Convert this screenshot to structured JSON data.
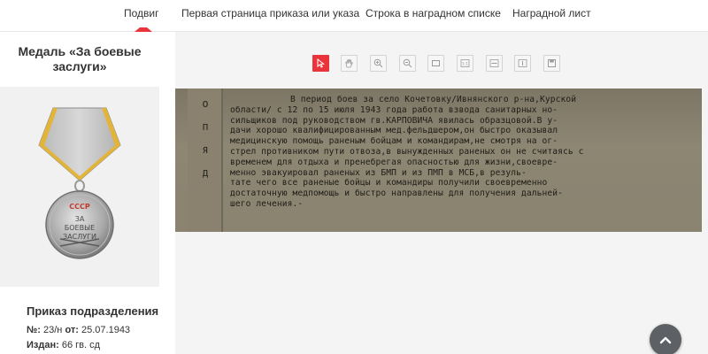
{
  "tabs": [
    {
      "label": "Подвиг",
      "active": true
    },
    {
      "label": "Первая страница приказа или указа",
      "active": false
    },
    {
      "label": "Строка в наградном списке",
      "active": false
    },
    {
      "label": "Наградной лист",
      "active": false
    }
  ],
  "colors": {
    "accent": "#e8343a",
    "viewer_bg": "#f4f4f4",
    "card_bg": "#f1f1f1"
  },
  "medal": {
    "title": "Медаль «За боевые заслуги»"
  },
  "order": {
    "title": "Приказ подразделения",
    "number_label": "№:",
    "number_value": "23/н",
    "date_label": "от:",
    "date_value": "25.07.1943",
    "issued_label": "Издан:",
    "issued_value": "66 гв. сд"
  },
  "toolbar": {
    "tools": [
      {
        "icon": "select-pointer-icon",
        "active": true
      },
      {
        "icon": "hand-pan-icon",
        "active": false
      },
      {
        "icon": "zoom-in-icon",
        "active": false
      },
      {
        "icon": "zoom-out-icon",
        "active": false
      },
      {
        "icon": "fit-page-icon",
        "active": false
      },
      {
        "icon": "actual-size-icon",
        "active": false
      },
      {
        "icon": "fit-width-icon",
        "active": false
      },
      {
        "icon": "fit-height-icon",
        "active": false
      },
      {
        "icon": "save-icon",
        "active": false
      }
    ]
  },
  "document": {
    "side_text": "о\nп\n\nя\n\nд",
    "lines": [
      "В период боев за село Кочетовку/Ивнянского р-на,Курской",
      "области/ с 12 по 15 июля 1943 года работа взвода санитарных но-",
      "сильщиков под руководством гв.КАРПОВИЧА явилась образцовой.В у-",
      "дачи хорошо квалифицированным мед.фельдшером,он быстро оказывал",
      "медицинскую помощь раненым бойцам и командирам,не смотря на ог-",
      "стрел противником пути отвоза,в вынужденных раненых он не считаясь с",
      "временем для отдыха и пренебрегая опасностью для жизни,своевре-",
      "менно эвакуировал раненых из БМП и из ПМП в МСБ,в резуль-",
      "тате чего все раненые бойцы и командиры получили своевременно",
      "достаточную медпомощь и быстро направлены для получения дальней-",
      "шего лечения.-"
    ]
  }
}
